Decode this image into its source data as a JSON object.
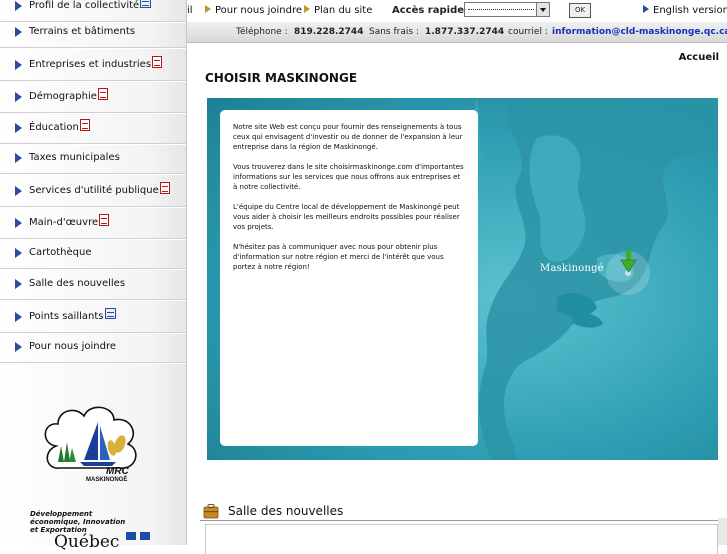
{
  "colors": {
    "accent_blue": "#2a4c9a",
    "link_blue": "#1a2fb5",
    "hero_teal": "#2f9fb3"
  },
  "sidebar": {
    "items": [
      {
        "label": "Profil de la collectivité",
        "icon": "document-icon"
      },
      {
        "label": "Terrains et bâtiments",
        "icon": null
      },
      {
        "label": "Entreprises et industries",
        "icon": "pdf-icon"
      },
      {
        "label": "Démographie",
        "icon": "pdf-icon"
      },
      {
        "label": "Éducation",
        "icon": "pdf-icon"
      },
      {
        "label": "Taxes municipales",
        "icon": null
      },
      {
        "label": "Services d'utilité publique",
        "icon": "pdf-icon"
      },
      {
        "label": "Main-d'œuvre",
        "icon": "pdf-icon"
      },
      {
        "label": "Cartothèque",
        "icon": null
      },
      {
        "label": "Salle des nouvelles",
        "icon": null
      },
      {
        "label": "Points saillants",
        "icon": "document-icon"
      },
      {
        "label": "Pour nous joindre",
        "icon": null
      }
    ],
    "logo": {
      "line1": "MRC",
      "line2": "MASKINONGÉ"
    },
    "ministry": {
      "line1": "Développement",
      "line2": "économique, Innovation",
      "line3": "et Exportation",
      "wordmark": "Québec"
    }
  },
  "topbar": {
    "partial_link": "il",
    "contact_link": "Pour nous joindre",
    "sitemap_link": "Plan du site",
    "quick_access_label": "Accès rapide :",
    "ok_label": "OK",
    "english_link": "English version"
  },
  "contact": {
    "phone_label": "Téléphone :",
    "phone": "819.228.2744",
    "tollfree_label": "Sans frais :",
    "tollfree": "1.877.337.2744",
    "email_label": "courriel :",
    "email": "information@cld-maskinonge.qc.ca"
  },
  "main": {
    "breadcrumb": "Accueil",
    "title": "CHOISIR MASKINONGE",
    "intro_paragraphs": [
      "Notre site Web est conçu pour fournir des renseignements à tous ceux qui envisagent d'investir ou de donner de l'expansion à leur entreprise dans la région de Maskinongé.",
      "Vous trouverez dans le site choisirmaskinonge.com d'importantes informations sur les services que nous offrons aux entreprises et à notre collectivité.",
      "L'équipe du Centre local de développement de Maskinongé peut vous aider à choisir les meilleurs endroits possibles pour réaliser vos projets.",
      "N'hésitez pas à communiquer avec nous pour obtenir plus d'information sur notre région et merci de l'intérêt que vous portez à notre région!"
    ],
    "map_label": "Maskinongé",
    "news_title": "Salle des nouvelles"
  }
}
